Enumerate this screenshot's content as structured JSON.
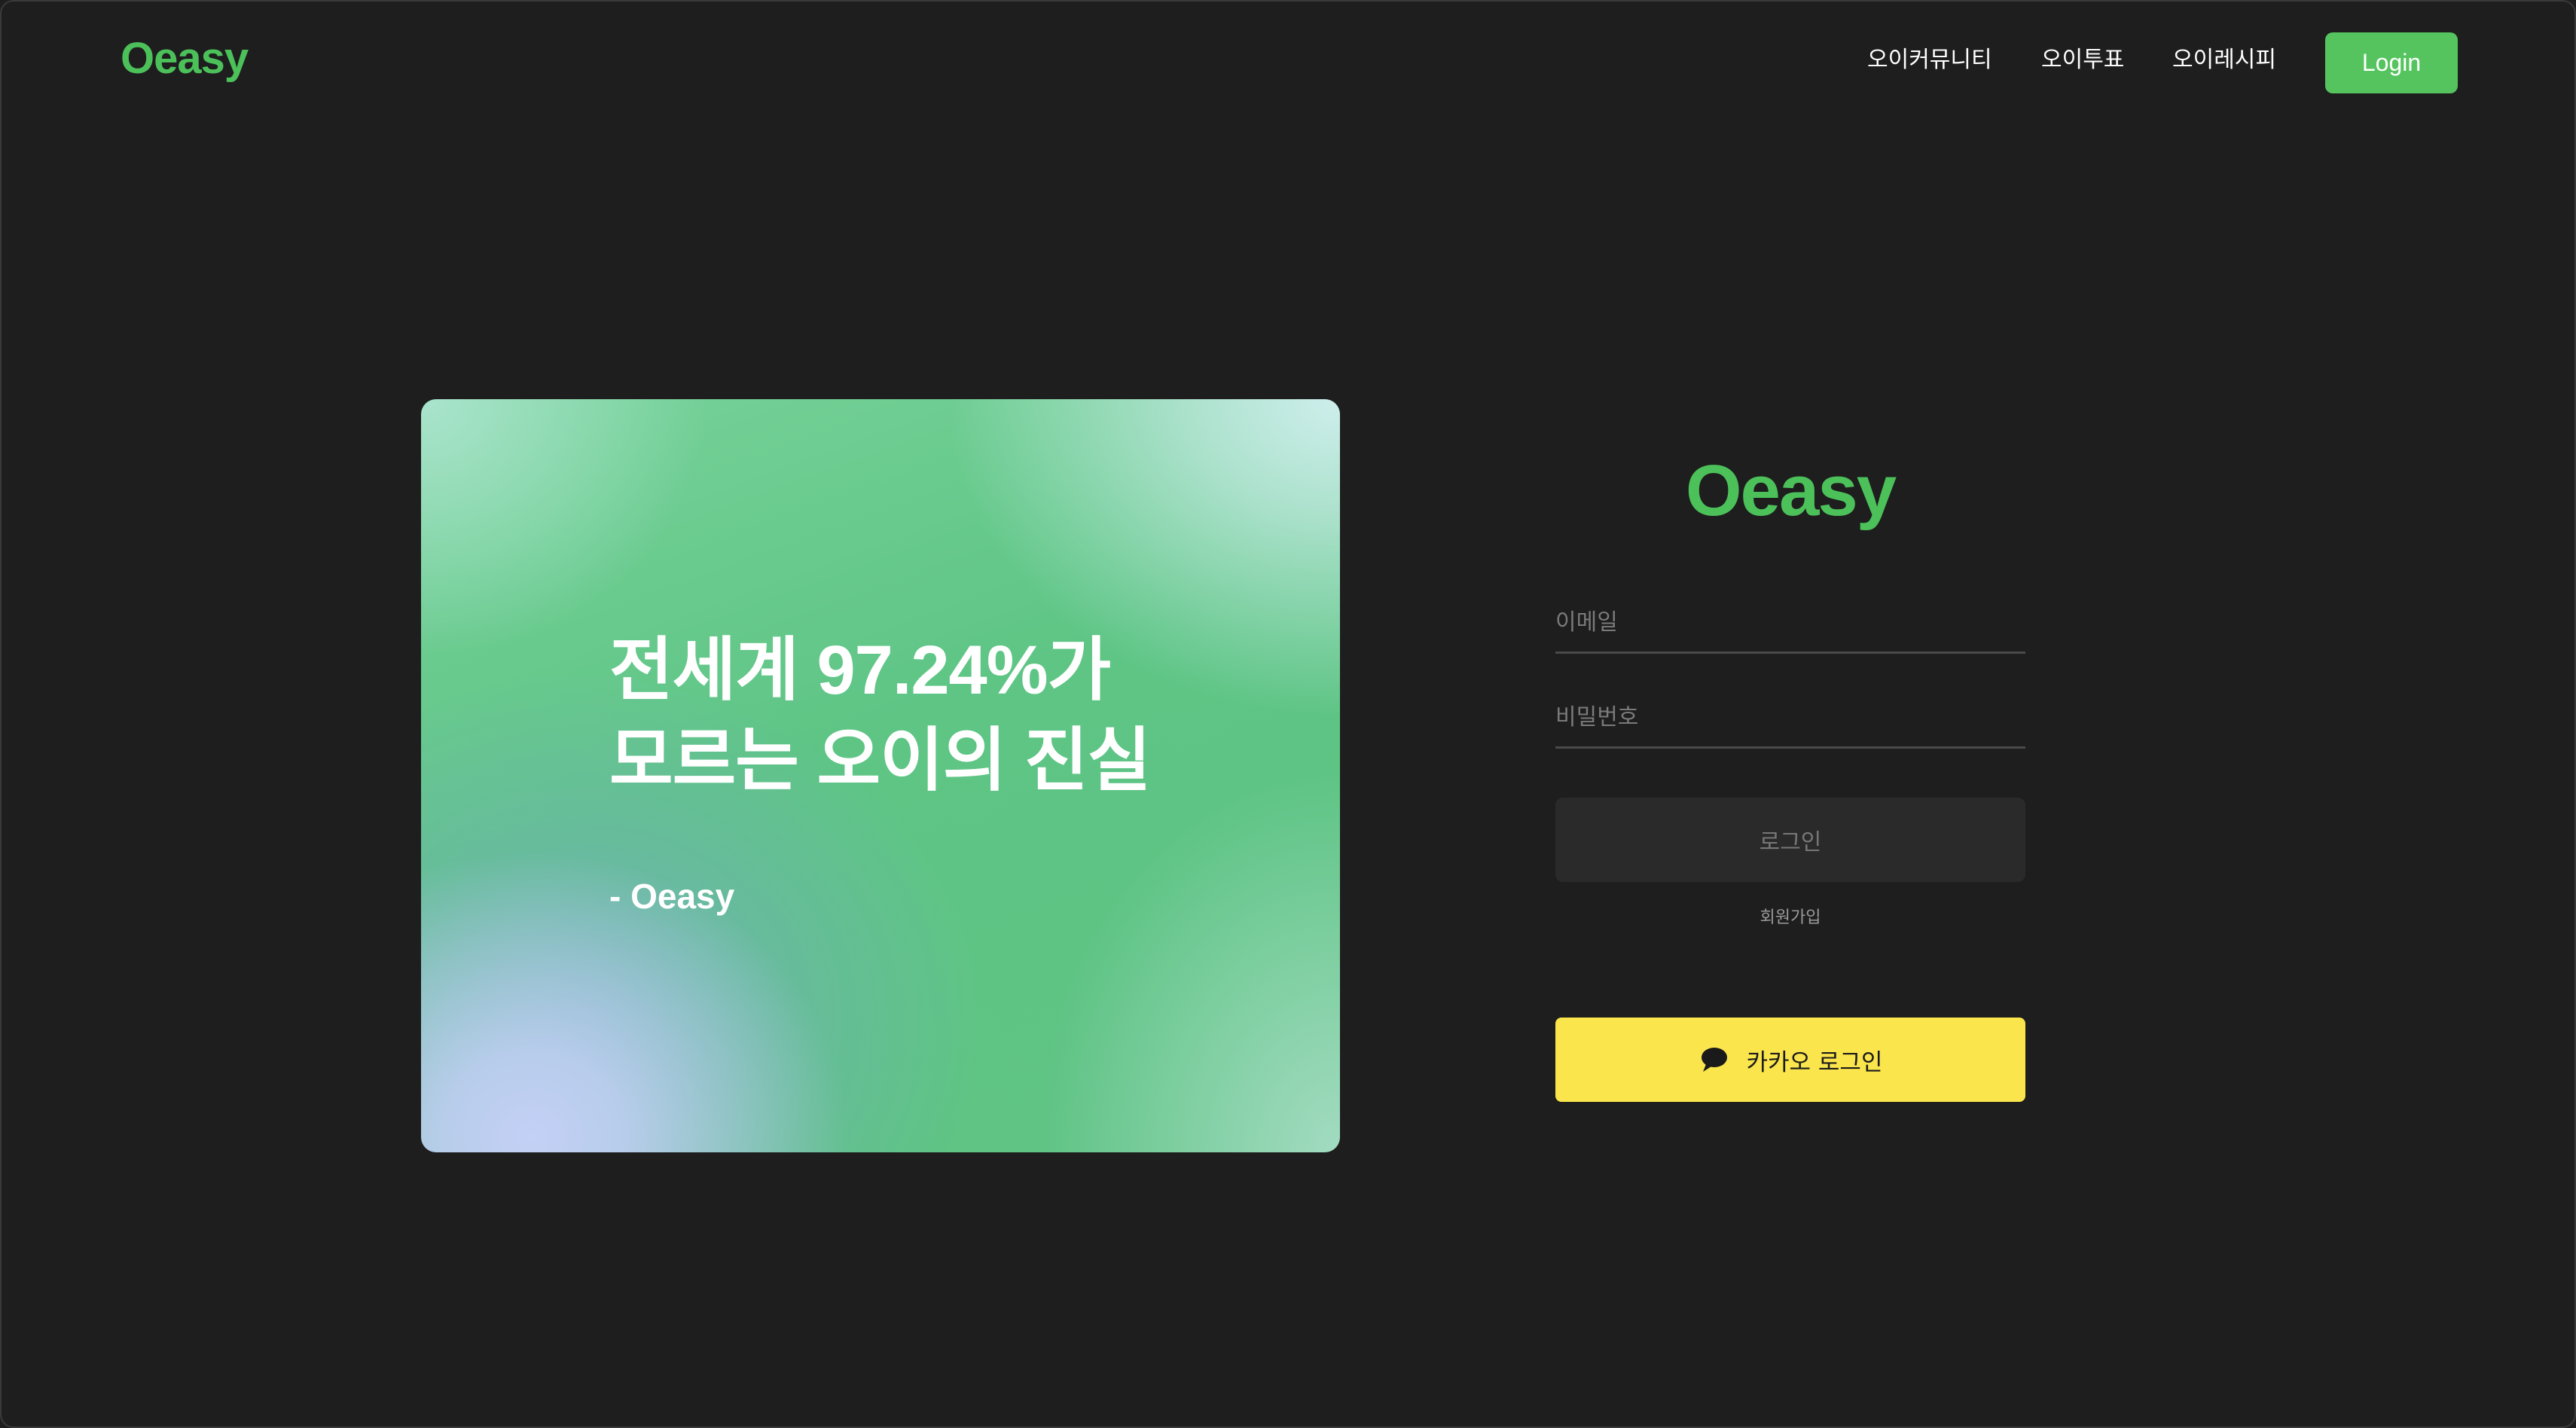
{
  "header": {
    "brand": "Oeasy",
    "nav": [
      {
        "label": "오이커뮤니티"
      },
      {
        "label": "오이투표"
      },
      {
        "label": "오이레시피"
      }
    ],
    "login_label": "Login"
  },
  "hero": {
    "line1": "전세계 97.24%가",
    "line2": "모르는 오이의 진실",
    "signature": "- Oeasy"
  },
  "login_panel": {
    "brand": "Oeasy",
    "email_placeholder": "이메일",
    "password_placeholder": "비밀번호",
    "submit_label": "로그인",
    "signup_label": "회원가입",
    "kakao_label": "카카오 로그인",
    "kakao_icon": "speech-bubble-icon"
  },
  "colors": {
    "brand_green": "#4cc15a",
    "kakao_yellow": "#fbe54d",
    "background": "#1e1e1e"
  }
}
